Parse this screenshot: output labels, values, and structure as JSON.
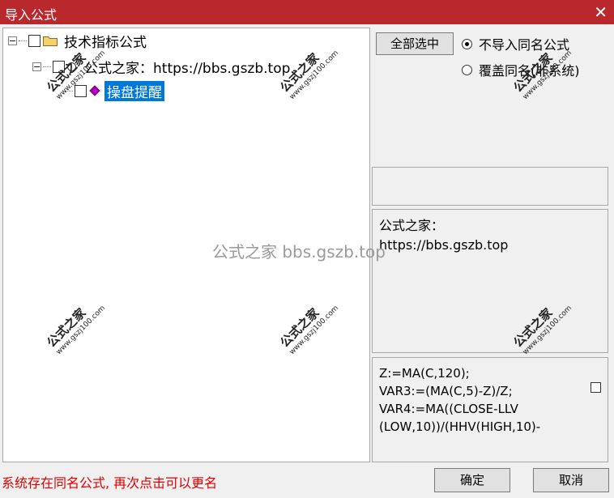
{
  "window": {
    "title": "导入公式",
    "close_glyph": "✕"
  },
  "tree": {
    "root": {
      "expander": "−",
      "label": "技术指标公式"
    },
    "child": {
      "expander": "−",
      "label": "公式之家：https://bbs.gszb.top"
    },
    "leaf": {
      "label": "操盘提醒"
    }
  },
  "actions": {
    "select_all": "全部选中",
    "radio_skip": "不导入同名公式",
    "radio_overwrite": "覆盖同名(非系统)",
    "ok": "确定",
    "cancel": "取消"
  },
  "description": {
    "line1": "公式之家：",
    "line2": "https://bbs.gszb.top"
  },
  "code": {
    "text": "Z:=MA(C,120);\nVAR3:=(MA(C,5)-Z)/Z;\nVAR4:=MA((CLOSE-LLV\n(LOW,10))/(HHV(HIGH,10)-"
  },
  "status_message": "系统存在同名公式, 再次点击可以更名",
  "watermarks": {
    "stamp_label": "公式之家",
    "stamp_url": "www.gszj100.com",
    "center": "公式之家 bbs.gszb.top"
  },
  "colors": {
    "titlebar": "#b8282d",
    "selection": "#0078d7",
    "status": "#e00000"
  }
}
